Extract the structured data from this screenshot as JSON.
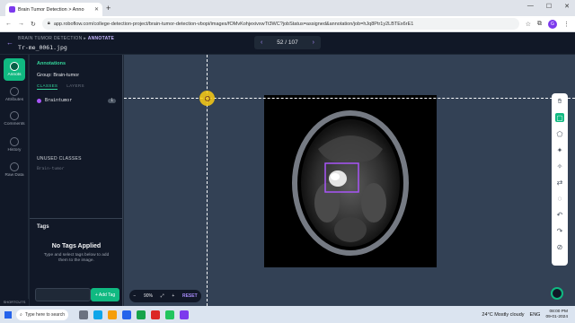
{
  "browser": {
    "tab_title": "Brain Tumor Detection > Anno",
    "url": "app.roboflow.com/college-detection-project/brain-tumor-detection-vbopi/images/fOMvKohjexivxwTt3WC?jobStatus=assigned&annotation/job=hJq8Ptr1y2LBTEx6rE1",
    "profile_initial": "G"
  },
  "header": {
    "breadcrumb_project": "BRAIN TUMOR DETECTION",
    "breadcrumb_mode": "ANNOTATE",
    "filename": "Tr-me_0061.jpg",
    "pager": "52 / 107"
  },
  "rail": {
    "items": [
      {
        "label": "Annots"
      },
      {
        "label": "Attributes"
      },
      {
        "label": "Comments"
      },
      {
        "label": "History"
      },
      {
        "label": "Raw Data"
      }
    ],
    "shortcuts": "SHORTCUTS"
  },
  "panel": {
    "title": "Annotations",
    "group": "Group: Brain-tumor",
    "tab_classes": "CLASSES",
    "tab_layers": "LAYERS",
    "class_name": "Braintumor",
    "class_count": "1",
    "unused_heading": "UNUSED CLASSES",
    "unused_item": "Brain-tumor",
    "tags_heading": "Tags",
    "tags_empty": "No Tags Applied",
    "tags_help": "Type and select tags below to add them to the image.",
    "add_tag": "+ Add Tag"
  },
  "zoom": {
    "value": "90%",
    "reset": "RESET"
  },
  "taskbar": {
    "search": "Type here to search",
    "weather": "24°C  Mostly cloudy",
    "lang": "ENG",
    "time": "08:00 PM",
    "date": "09-01-2024"
  },
  "colors": {
    "accent": "#10b981",
    "bbox": "#a855f7",
    "cursor": "#facc15"
  }
}
